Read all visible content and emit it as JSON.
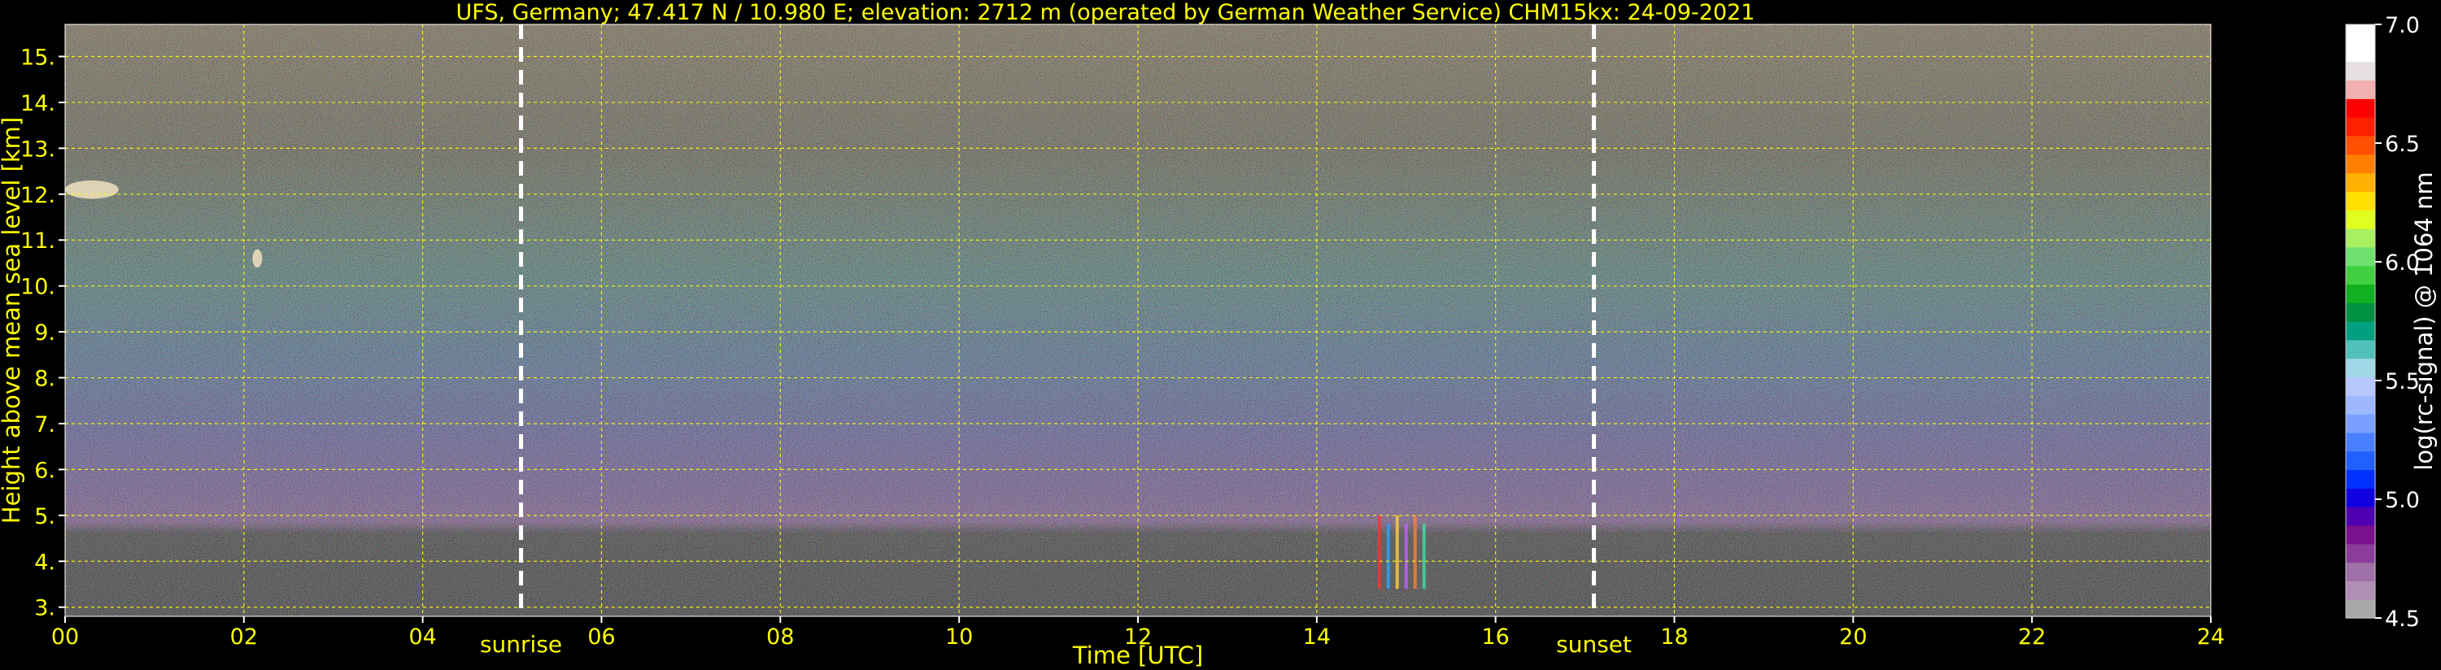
{
  "chart_data": {
    "type": "heatmap",
    "title": "UFS, Germany; 47.417 N / 10.980 E; elevation: 2712 m  (operated by German Weather Service)     CHM15kx: 24-09-2021",
    "xlabel": "Time [UTC]",
    "ylabel": "Height above mean sea level [km]",
    "xlim": [
      0,
      24
    ],
    "ylim": [
      2.8,
      15.7
    ],
    "x_ticks": [
      0,
      2,
      4,
      6,
      8,
      10,
      12,
      14,
      16,
      18,
      20,
      22,
      24
    ],
    "x_tick_labels": [
      "00",
      "02",
      "04",
      "06",
      "08",
      "10",
      "12",
      "14",
      "16",
      "18",
      "20",
      "22",
      "24"
    ],
    "y_ticks": [
      3,
      4,
      5,
      6,
      7,
      8,
      9,
      10,
      11,
      12,
      13,
      14,
      15
    ],
    "y_tick_labels": [
      "3.",
      "4.",
      "5.",
      "6.",
      "7.",
      "8.",
      "9.",
      "10.",
      "11.",
      "12.",
      "13.",
      "14.",
      "15."
    ],
    "grid": true,
    "grid_color": "#ffff00",
    "events": [
      {
        "label": "sunrise",
        "x": 5.1
      },
      {
        "label": "sunset",
        "x": 17.1
      }
    ],
    "colorbar": {
      "label": "log(rc-signal) @ 1064 nm",
      "range": [
        4.5,
        7.0
      ],
      "ticks": [
        4.5,
        5.0,
        5.5,
        6.0,
        6.5,
        7.0
      ],
      "tick_labels": [
        "4.5",
        "5.0",
        "5.5",
        "6.0",
        "6.5",
        "7.0"
      ],
      "colors": [
        "#a8a8a8",
        "#b18eb4",
        "#a070a8",
        "#8a3e9a",
        "#7a108e",
        "#5000b0",
        "#1000e0",
        "#0030ff",
        "#2060ff",
        "#4a80ff",
        "#7aa0ff",
        "#9db8ff",
        "#b8c8ff",
        "#a0d8e8",
        "#50c0b8",
        "#00a080",
        "#009040",
        "#10b020",
        "#40d040",
        "#70e070",
        "#a8f060",
        "#e0ff20",
        "#ffe000",
        "#ffb000",
        "#ff8000",
        "#ff5000",
        "#ff2000",
        "#ff0000",
        "#f0b0b0",
        "#e8e0e0",
        "#ffffff",
        "#ffffff"
      ]
    },
    "features": [
      {
        "name": "cirrus cloud",
        "x_range": [
          0.0,
          0.6
        ],
        "y_range": [
          11.9,
          12.3
        ]
      },
      {
        "name": "cloud fragment",
        "x_range": [
          2.1,
          2.2
        ],
        "y_range": [
          10.4,
          10.8
        ]
      },
      {
        "name": "precipitation streaks",
        "x_range": [
          14.7,
          15.2
        ],
        "y_range": [
          3.4,
          5.0
        ]
      }
    ]
  }
}
